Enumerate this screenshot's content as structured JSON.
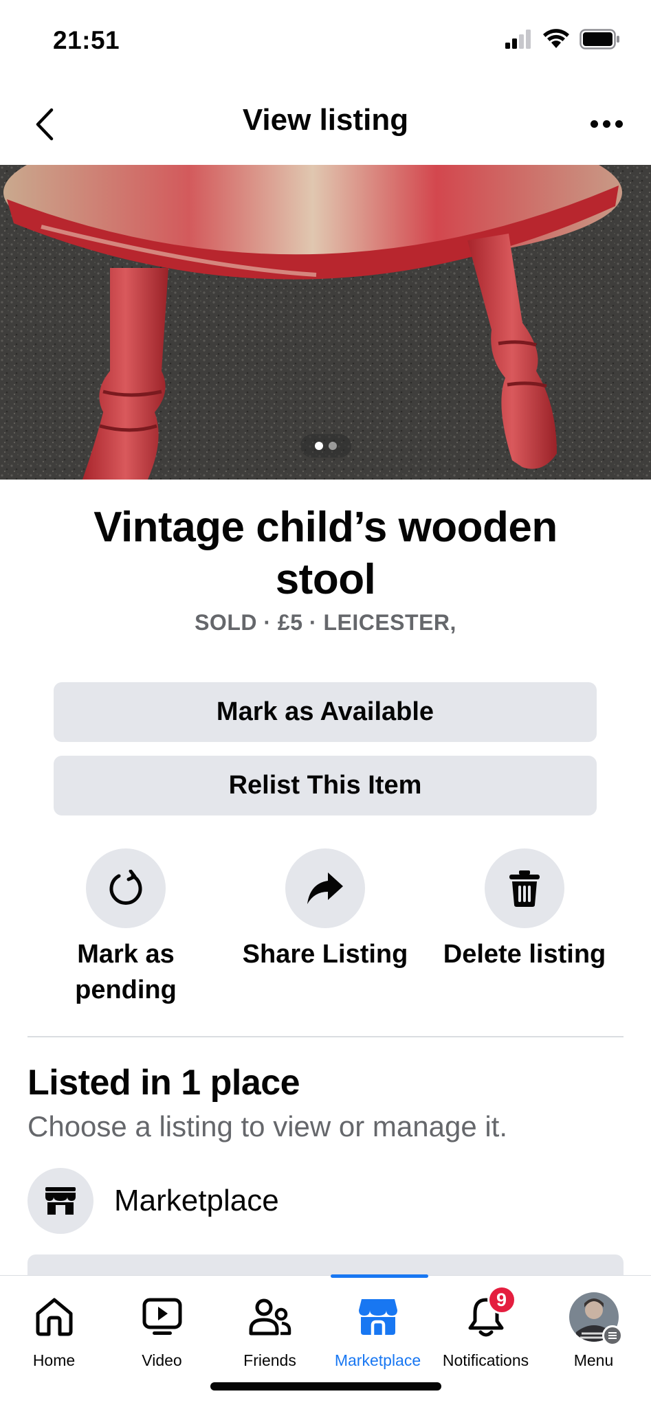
{
  "status_bar": {
    "time": "21:51",
    "icons": [
      "cellular-signal-icon",
      "wifi-icon",
      "battery-icon"
    ]
  },
  "header": {
    "title": "View listing",
    "back_icon": "chevron-left-icon",
    "more_icon": "more-horizontal-icon"
  },
  "photo": {
    "description_icon": "listing-photo",
    "page_count": 2,
    "active_page": 1
  },
  "listing": {
    "title": "Vintage child’s wooden stool",
    "meta": "SOLD · £5 · LEICESTER,"
  },
  "buttons": {
    "mark_available": "Mark as Available",
    "relist": "Relist This Item"
  },
  "actions": [
    {
      "label": "Mark as pending",
      "icon": "refresh-icon"
    },
    {
      "label": "Share Listing",
      "icon": "share-arrow-icon"
    },
    {
      "label": "Delete listing",
      "icon": "trash-icon"
    }
  ],
  "listed_section": {
    "title": "Listed in 1 place",
    "subtitle": "Choose a listing to view or manage it.",
    "places": [
      {
        "label": "Marketplace",
        "icon": "storefront-icon"
      }
    ]
  },
  "bottom_nav": {
    "items": [
      {
        "label": "Home",
        "icon": "home-icon",
        "active": false
      },
      {
        "label": "Video",
        "icon": "video-icon",
        "active": false
      },
      {
        "label": "Friends",
        "icon": "friends-icon",
        "active": false
      },
      {
        "label": "Marketplace",
        "icon": "marketplace-icon",
        "active": true
      },
      {
        "label": "Notifications",
        "icon": "bell-icon",
        "active": false,
        "badge": "9"
      },
      {
        "label": "Menu",
        "icon": "avatar",
        "active": false
      }
    ]
  },
  "colors": {
    "accent": "#1877f2",
    "button_bg": "#e4e6eb",
    "secondary_text": "#65676b",
    "badge": "#e41e3f"
  }
}
